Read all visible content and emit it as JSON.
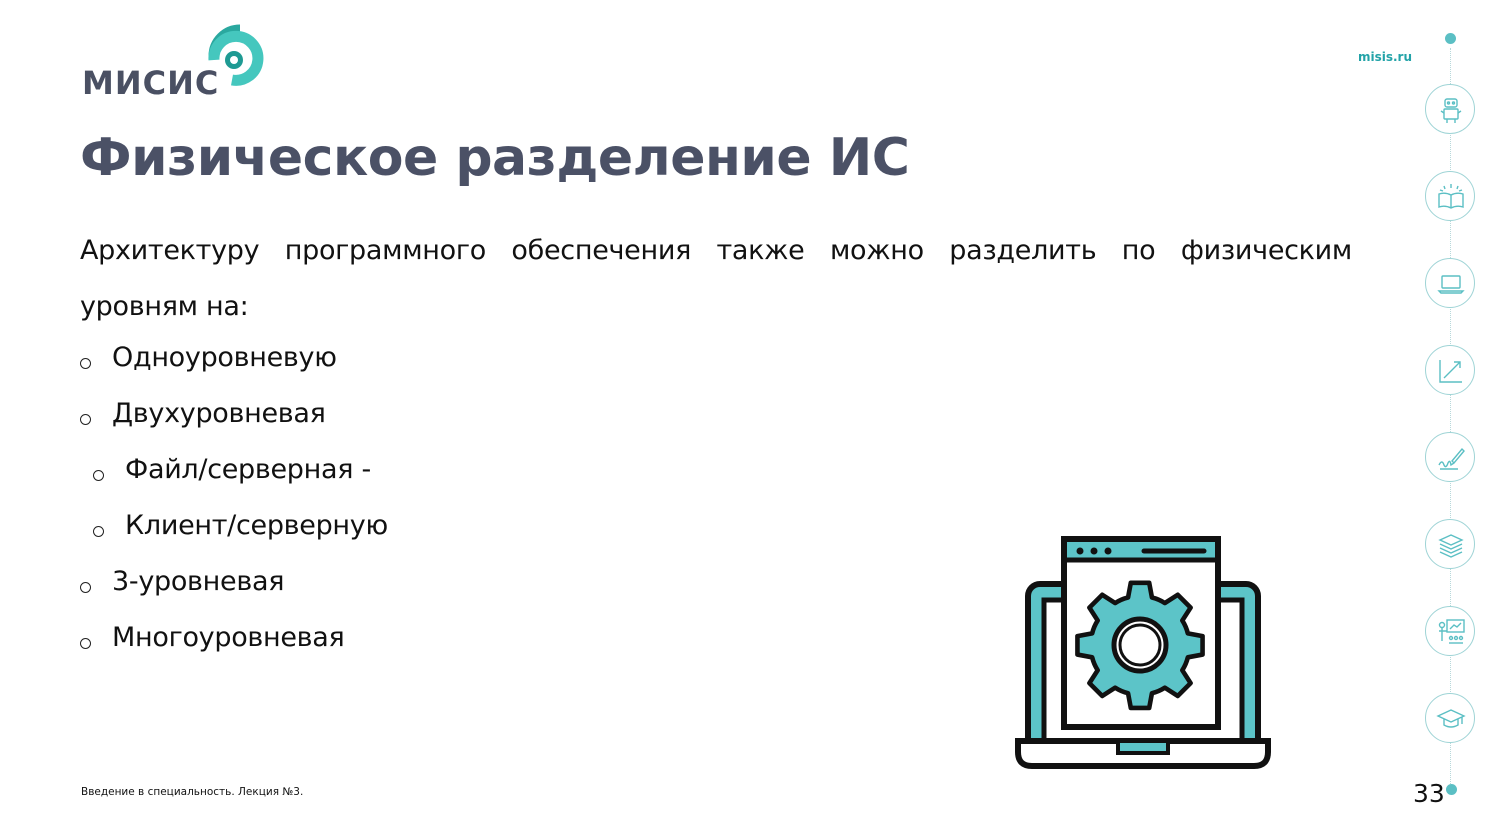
{
  "header": {
    "logo_text": "МИСИС",
    "site": "misis.ru"
  },
  "slide": {
    "title": "Физическое разделение ИС",
    "intro": "Архитектуру программного обеспечения также можно разделить по физическим уровням на:",
    "bullets": [
      {
        "text": "Одноуровневую",
        "level": 1
      },
      {
        "text": "Двухуровневая",
        "level": 1
      },
      {
        "text": "Файл/серверная -",
        "level": 2
      },
      {
        "text": "Клиент/серверную",
        "level": 2
      },
      {
        "text": "3-уровневая",
        "level": 1
      },
      {
        "text": "Многоуровневая",
        "level": 1
      }
    ]
  },
  "footer": {
    "text": "Введение в специальность. Лекция №3.",
    "page_number": "33"
  },
  "rail_icons": [
    "robot-icon",
    "book-icon",
    "laptop-icon",
    "chart-icon",
    "signature-icon",
    "books-stack-icon",
    "teacher-icon",
    "graduation-cap-icon"
  ],
  "colors": {
    "accent": "#5bbfc4",
    "title": "#4b5166",
    "logo_text": "#4a5063",
    "site": "#23a3a8"
  }
}
